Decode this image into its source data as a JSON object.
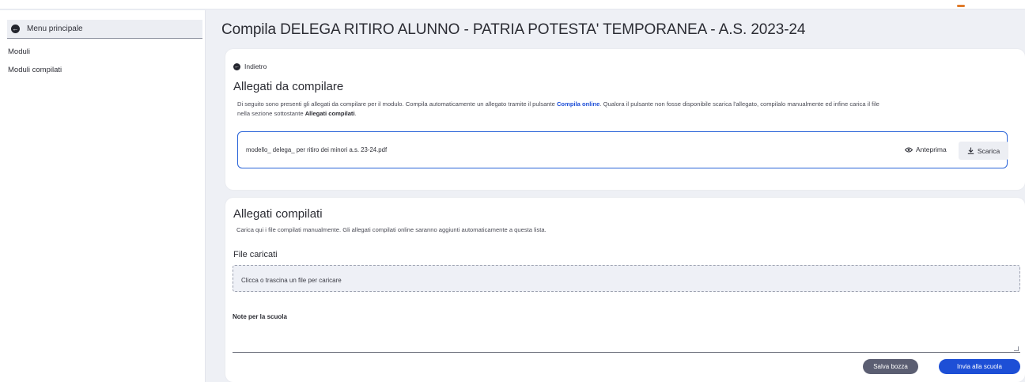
{
  "sidebar": {
    "menu_principale": "Menu principale",
    "items": [
      {
        "label": "Moduli"
      },
      {
        "label": "Moduli compilati"
      }
    ]
  },
  "main": {
    "title": "Compila DELEGA RITIRO ALUNNO - PATRIA POTESTA' TEMPORANEA - A.S. 2023-24",
    "back_label": "Indietro",
    "allegati_da_compilare": {
      "title": "Allegati da compilare",
      "desc_part1": "Di seguito sono presenti gli allegati da compilare per il modulo. Compila automaticamente un allegato tramite il pulsante ",
      "desc_bold_blue": "Compila online",
      "desc_part2": ". Qualora il pulsante non fosse disponibile scarica l'allegato, compilalo manualmente ed infine carica il file",
      "desc_part3": "nella sezione sottostante ",
      "desc_bold": "Allegati compilati",
      "desc_end": ".",
      "file": {
        "name": "modello_ delega_ per ritiro dei minori a.s. 23-24.pdf",
        "preview_label": "Anteprima",
        "download_label": "Scarica"
      }
    },
    "allegati_compilati": {
      "title": "Allegati compilati",
      "desc": "Carica qui i file compilati manualmente. Gli allegati compilati online saranno aggiunti automaticamente a questa lista.",
      "file_caricati_label": "File caricati",
      "dropzone_text": "Clicca o trascina un file per caricare",
      "notes_label": "Note per la scuola",
      "notes_value": "",
      "save_draft_label": "Salva bozza",
      "send_label": "Invia alla scuola"
    }
  },
  "colors": {
    "primary": "#1d4fd6",
    "secondary_button": "#5b5e72",
    "background": "#eef0f5"
  },
  "icons": {
    "back": "arrow-left-circle-icon",
    "preview": "eye-icon",
    "download": "download-icon"
  }
}
